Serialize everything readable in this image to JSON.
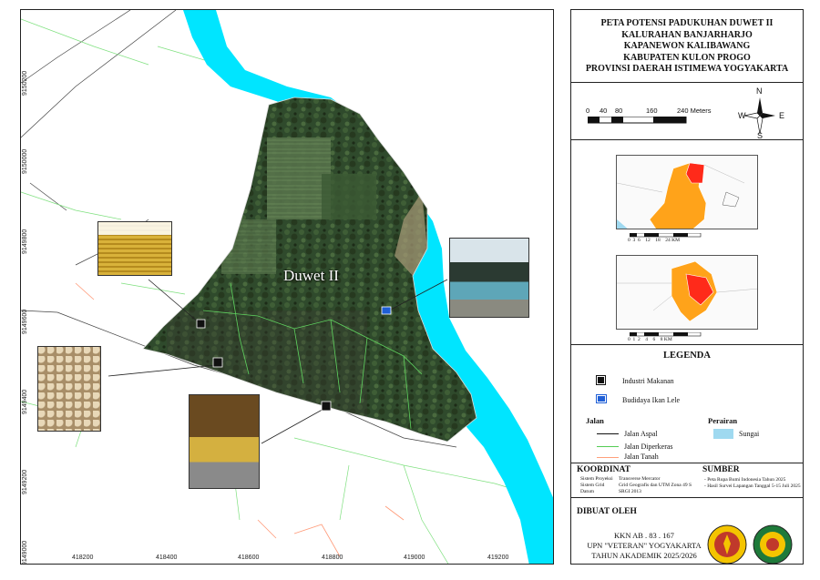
{
  "map": {
    "area_label": "Duwet II",
    "x_ticks": [
      "418200",
      "418400",
      "418600",
      "418800",
      "419000",
      "419200"
    ],
    "y_ticks": [
      "9150200",
      "9150000",
      "9149800",
      "9149600",
      "9149400",
      "9149200",
      "9149000"
    ]
  },
  "title": {
    "lines": [
      "PETA POTENSI PADUKUHAN DUWET II",
      "KALURAHAN BANJARHARJO",
      "KAPANEWON KALIBAWANG",
      "KABUPATEN KULON PROGO",
      "PROVINSI DAERAH ISTIMEWA YOGYAKARTA"
    ]
  },
  "scalebar": {
    "labels": [
      "0",
      "40",
      "80",
      "160",
      "240 Meters"
    ]
  },
  "north_arrow": {
    "n": "N",
    "s": "S",
    "e": "E",
    "w": "W"
  },
  "inset1": {
    "scale_labels": [
      "0",
      "3",
      "6",
      "12",
      "18",
      "24"
    ],
    "unit": "KM"
  },
  "inset2": {
    "scale_labels": [
      "0",
      "1",
      "2",
      "4",
      "6",
      "8"
    ],
    "unit": "KM"
  },
  "legend": {
    "title": "LEGENDA",
    "points": [
      {
        "label": "Industri Makanan",
        "icon": "food-industry-icon"
      },
      {
        "label": "Budidaya Ikan Lele",
        "icon": "catfish-farming-icon"
      }
    ],
    "jalan_title": "Jalan",
    "roads": [
      {
        "label": "Jalan Aspal",
        "color": "#111111"
      },
      {
        "label": "Jalan Diperkeras",
        "color": "#55cc55"
      },
      {
        "label": "Jalan Tanah",
        "color": "#ffa07a"
      }
    ],
    "perairan_title": "Perairan",
    "water": [
      {
        "label": "Sungai",
        "color": "#9fd9f0"
      }
    ]
  },
  "koordinat": {
    "title": "KOORDINAT",
    "rows": [
      {
        "k": "Sistem Proyeksi",
        "v": "Transverse Mercator"
      },
      {
        "k": "Sistem Grid",
        "v": "Grid Geografis dan UTM Zona 49 S"
      },
      {
        "k": "Datum",
        "v": "SRGI 2013"
      }
    ]
  },
  "sumber": {
    "title": "SUMBER",
    "lines": [
      "- Peta Rupa Bumi Indonesia Tahun 2025",
      "- Hasil Survei Lapangan Tanggal 5-15 Juli 2025"
    ]
  },
  "dibuat": {
    "title": "DIBUAT OLEH",
    "lines": [
      "KKN AB . 83 . 167",
      "UPN \"VETERAN\" YOGYAKARTA",
      "TAHUN AKADEMIK 2025/2026"
    ]
  },
  "colors": {
    "river": "#00e5ff",
    "highlight": "#ff2a1a",
    "region": "#ffa31a"
  }
}
